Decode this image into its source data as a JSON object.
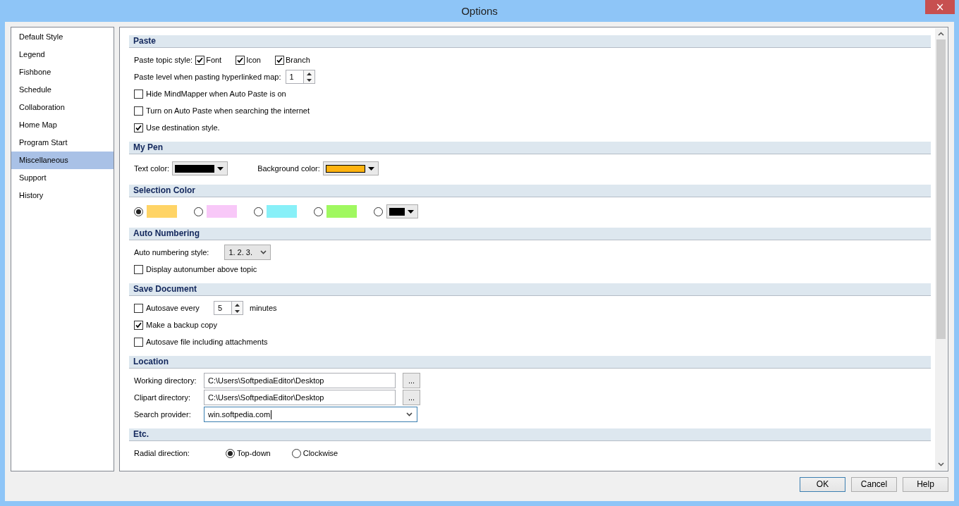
{
  "window": {
    "title": "Options",
    "close": "×"
  },
  "sidebar": {
    "items": [
      {
        "label": "Default Style",
        "selected": false
      },
      {
        "label": "Legend",
        "selected": false
      },
      {
        "label": "Fishbone",
        "selected": false
      },
      {
        "label": "Schedule",
        "selected": false
      },
      {
        "label": "Collaboration",
        "selected": false
      },
      {
        "label": "Home Map",
        "selected": false
      },
      {
        "label": "Program Start",
        "selected": false
      },
      {
        "label": "Miscellaneous",
        "selected": true
      },
      {
        "label": "Support",
        "selected": false
      },
      {
        "label": "History",
        "selected": false
      }
    ]
  },
  "sections": [
    {
      "title": "Paste",
      "rows": [
        {
          "kind": "checkbox_group",
          "label": "Paste topic style:",
          "options": [
            {
              "label": "Font",
              "checked": true
            },
            {
              "label": "Icon",
              "checked": true
            },
            {
              "label": "Branch",
              "checked": true
            }
          ]
        },
        {
          "kind": "spin",
          "label": "Paste level when pasting hyperlinked map:",
          "value": "1"
        },
        {
          "kind": "checkbox",
          "label": "Hide MindMapper when Auto Paste is on",
          "checked": false
        },
        {
          "kind": "checkbox",
          "label": "Turn on Auto Paste when searching the internet",
          "checked": false
        },
        {
          "kind": "checkbox",
          "label": "Use destination style.",
          "checked": true
        }
      ]
    },
    {
      "title": "My Pen",
      "rows": [
        {
          "kind": "color_pickers",
          "pickers": [
            {
              "label": "Text color:",
              "color": "#000000"
            },
            {
              "label": "Background color:",
              "color": "#ffb310"
            }
          ]
        }
      ]
    },
    {
      "title": "Selection Color",
      "rows": [
        {
          "kind": "swatches",
          "options": [
            {
              "kind": "swatch",
              "color": "#ffd466",
              "selected": true
            },
            {
              "kind": "swatch",
              "color": "#f8c8f8",
              "selected": false
            },
            {
              "kind": "swatch",
              "color": "#88f0f8",
              "selected": false
            },
            {
              "kind": "swatch",
              "color": "#a0f860",
              "selected": false
            },
            {
              "kind": "picker",
              "color": "#000000",
              "selected": false
            }
          ]
        }
      ]
    },
    {
      "title": "Auto Numbering",
      "rows": [
        {
          "kind": "select",
          "label": "Auto numbering style:",
          "value": "1. 2. 3."
        },
        {
          "kind": "checkbox",
          "label": "Display autonumber above topic",
          "checked": false
        }
      ]
    },
    {
      "title": "Save Document",
      "rows": [
        {
          "kind": "checkbox_spin",
          "label": "Autosave every",
          "checked": false,
          "value": "5",
          "suffix": "minutes"
        },
        {
          "kind": "checkbox",
          "label": "Make a backup copy",
          "checked": true
        },
        {
          "kind": "checkbox",
          "label": "Autosave file including attachments",
          "checked": false
        }
      ]
    },
    {
      "title": "Location",
      "rows": [
        {
          "kind": "path",
          "label": "Working directory:",
          "value": "C:\\Users\\SoftpediaEditor\\Desktop",
          "button": "..."
        },
        {
          "kind": "path",
          "label": "Clipart directory:",
          "value": "C:\\Users\\SoftpediaEditor\\Desktop",
          "button": "..."
        },
        {
          "kind": "combo",
          "label": "Search provider:",
          "value": "win.softpedia.com"
        }
      ]
    },
    {
      "title": "Etc.",
      "rows": [
        {
          "kind": "radios",
          "label": "Radial direction:",
          "options": [
            {
              "label": "Top-down",
              "selected": true
            },
            {
              "label": "Clockwise",
              "selected": false
            }
          ]
        }
      ]
    }
  ],
  "buttons": [
    {
      "label": "OK",
      "default": true
    },
    {
      "label": "Cancel",
      "default": false
    },
    {
      "label": "Help",
      "default": false
    }
  ]
}
